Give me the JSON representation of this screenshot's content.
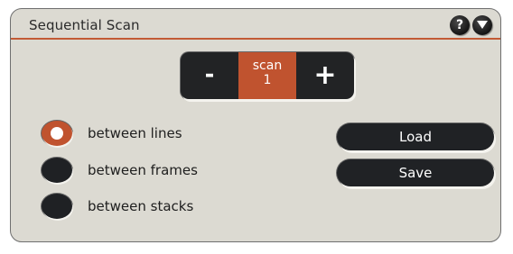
{
  "panel": {
    "title": "Sequential Scan",
    "help_icon_glyph": "?",
    "icons": {
      "help": "help-icon",
      "menu": "chevron-down-icon"
    }
  },
  "stepper": {
    "minus_label": "-",
    "plus_label": "+",
    "value_label": "scan",
    "value": "1"
  },
  "radio_options": [
    {
      "label": "between lines",
      "selected": true
    },
    {
      "label": "between frames",
      "selected": false
    },
    {
      "label": "between stacks",
      "selected": false
    }
  ],
  "buttons": {
    "load_label": "Load",
    "save_label": "Save"
  },
  "colors": {
    "accent": "#c0532f",
    "control_dark": "#222325",
    "panel_bg": "#dcdad2"
  }
}
